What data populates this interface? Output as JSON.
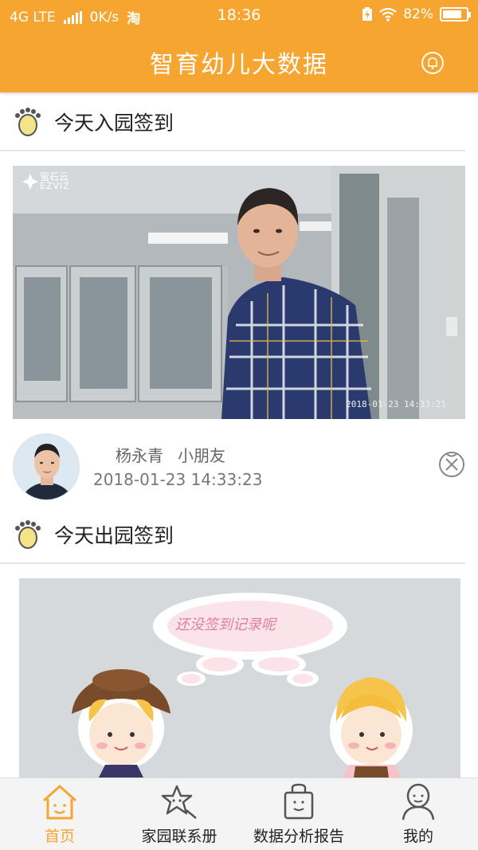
{
  "status_bar": {
    "network": "4G LTE",
    "speed": "0K/s",
    "app_icon_glyph": "淘",
    "time": "18:36",
    "battery_percent": "82%",
    "battery_level": 0.82
  },
  "header": {
    "title": "智育幼儿大数据",
    "bell_icon": "bell-icon"
  },
  "checkin_in": {
    "section_title": "今天入园签到",
    "camera": {
      "brand_cn": "萤石云",
      "brand_en": "EZVIZ",
      "timestamp": "2018-01-23 14:33:21"
    },
    "record": {
      "name": "杨永青",
      "role": "小朋友",
      "time": "2018-01-23 14:33:23"
    }
  },
  "checkin_out": {
    "section_title": "今天出园签到",
    "placeholder_text": "还没签到记录呢"
  },
  "tabbar": {
    "items": [
      {
        "label": "首页",
        "icon": "home-icon",
        "active": true
      },
      {
        "label": "家园联系册",
        "icon": "star-message-icon",
        "active": false
      },
      {
        "label": "数据分析报告",
        "icon": "report-bag-icon",
        "active": false
      },
      {
        "label": "我的",
        "icon": "person-icon",
        "active": false
      }
    ]
  },
  "colors": {
    "accent": "#f7a531",
    "active_tab": "#f7a531"
  }
}
